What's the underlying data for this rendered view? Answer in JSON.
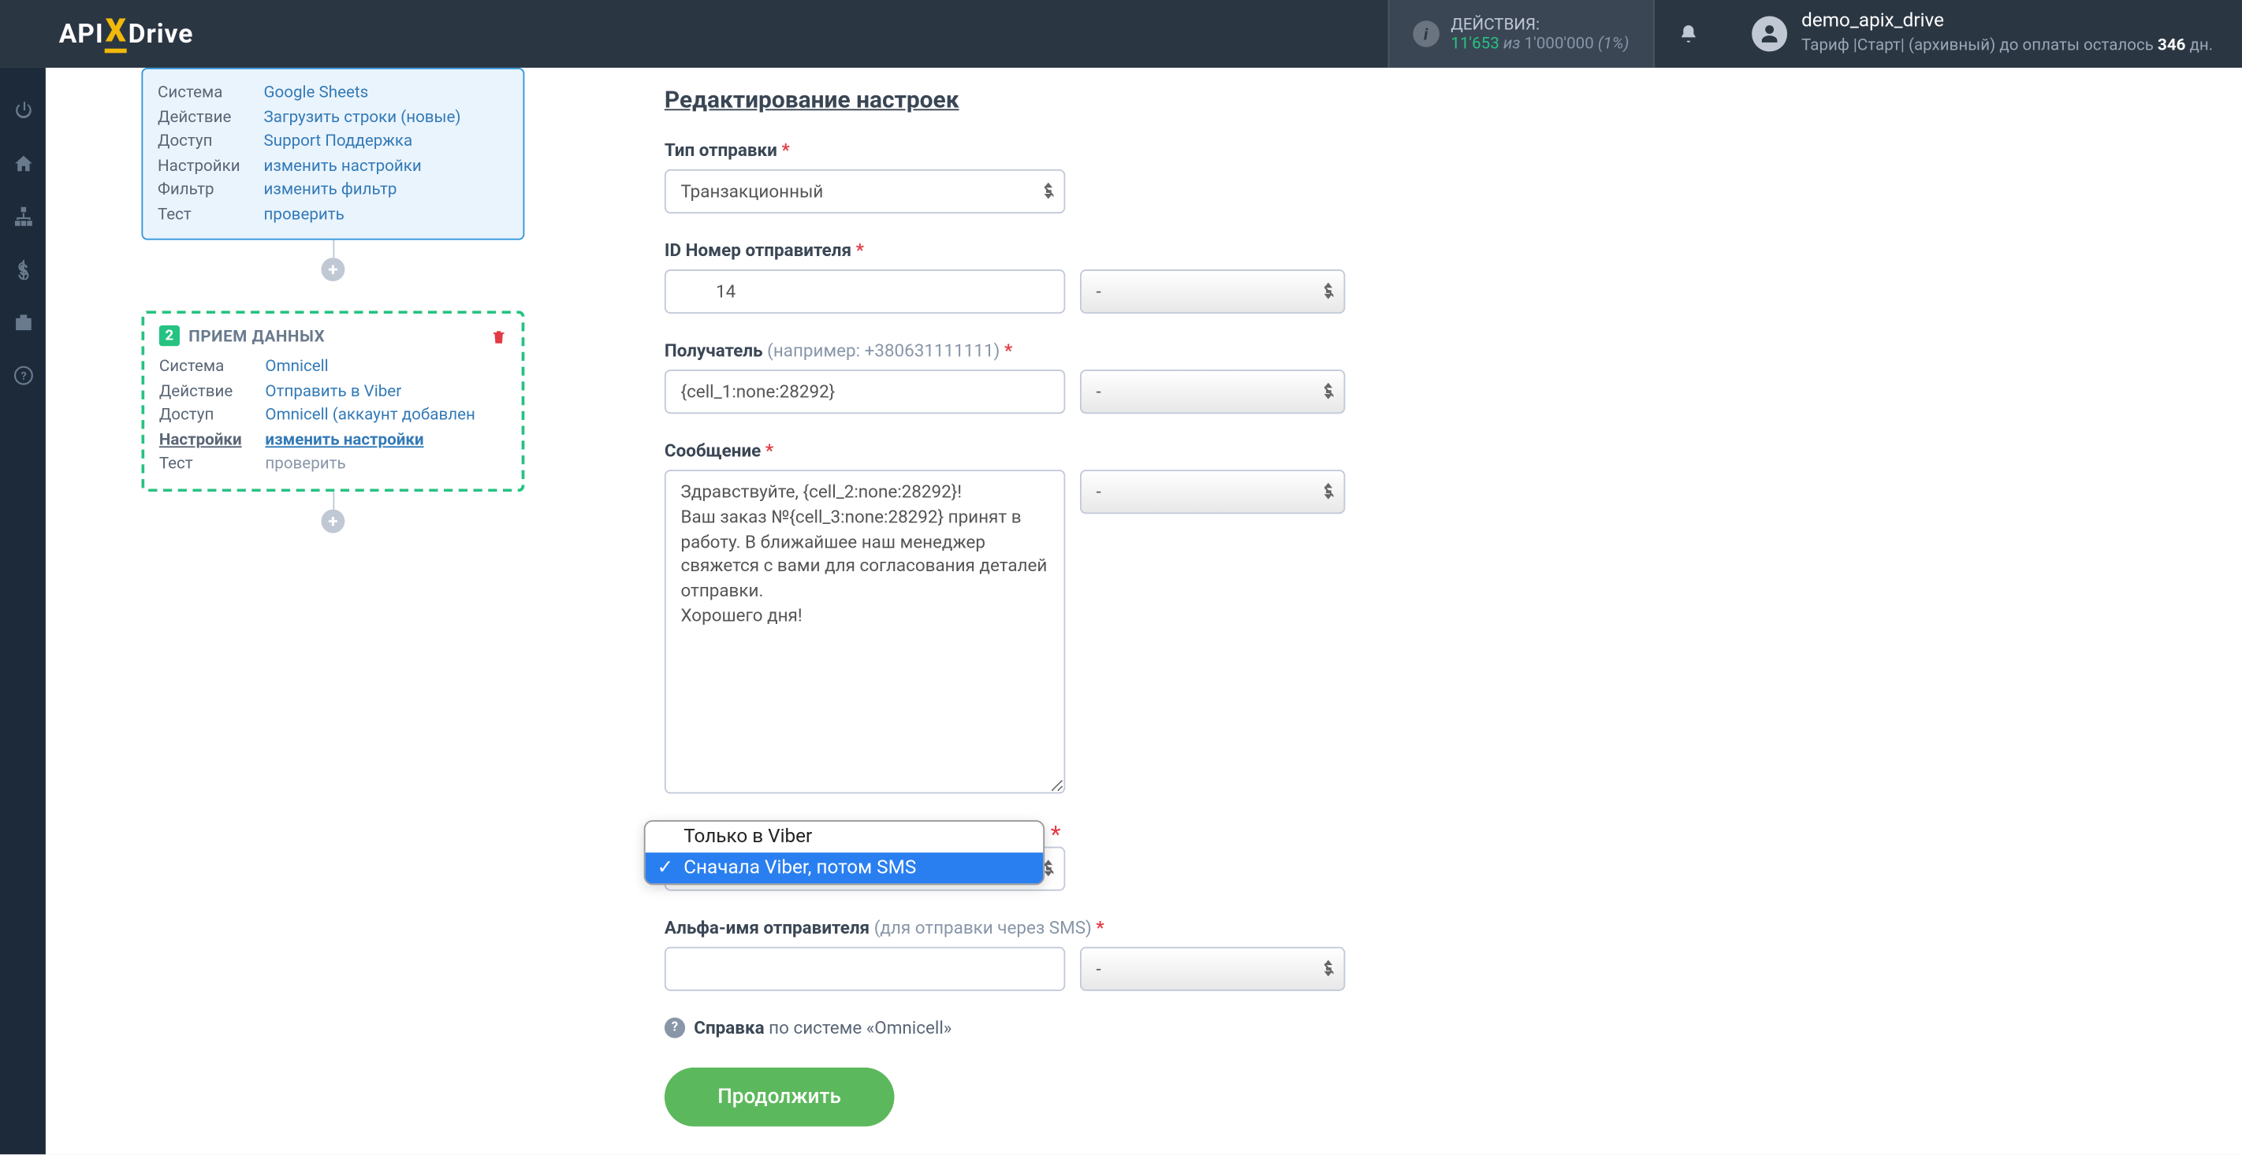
{
  "header": {
    "logo_prefix": "API",
    "logo_x": "X",
    "logo_suffix": "Drive",
    "actions": {
      "label": "действия:",
      "current": "11'653",
      "of_word": "из",
      "total": "1'000'000",
      "percent": "(1%)"
    },
    "user": {
      "name": "demo_apix_drive",
      "tariff_prefix": "Тариф |Старт| (архивный) до оплаты осталось ",
      "tariff_days": "346",
      "tariff_suffix": " дн."
    }
  },
  "sidebar": {
    "step1": {
      "rows": [
        {
          "label": "Система",
          "value": "Google Sheets",
          "link": true
        },
        {
          "label": "Действие",
          "value": "Загрузить строки (новые)",
          "link": true
        },
        {
          "label": "Доступ",
          "value": "Support Поддержка",
          "link": true
        },
        {
          "label": "Настройки",
          "value": "изменить настройки",
          "link": true
        },
        {
          "label": "Фильтр",
          "value": "изменить фильтр",
          "link": true
        },
        {
          "label": "Тест",
          "value": "проверить",
          "link": true
        }
      ]
    },
    "step2": {
      "num": "2",
      "title": "ПРИЕМ ДАННЫХ",
      "rows": [
        {
          "label": "Система",
          "value": "Omnicell",
          "link": true
        },
        {
          "label": "Действие",
          "value": "Отправить в Viber",
          "link": true
        },
        {
          "label": "Доступ",
          "value": "Omnicell (аккаунт добавлен",
          "link": true
        },
        {
          "label": "Настройки",
          "value": "изменить настройки",
          "link": true,
          "active": true
        },
        {
          "label": "Тест",
          "value": "проверить",
          "link": false
        }
      ]
    }
  },
  "form": {
    "title": "Редактирование настроек",
    "fields": {
      "send_type": {
        "label": "Тип отправки",
        "value": "Транзакционный"
      },
      "sender_id": {
        "label": "ID Номер отправителя",
        "value": "        14",
        "select": "-"
      },
      "recipient": {
        "label": "Получатель",
        "hint": "(например: +380631111111)",
        "value": "{cell_1:none:28292}",
        "select": "-"
      },
      "message": {
        "label": "Сообщение",
        "value": "Здравствуйте, {cell_2:none:28292}!\nВаш заказ №{cell_3:none:28292} принят в работу. В ближайшее наш менеджер свяжется с вами для согласования деталей отправки.\nХорошего дня!",
        "select": "-"
      },
      "channel": {
        "options": [
          {
            "text": "Только в Viber",
            "selected": false
          },
          {
            "text": "Сначала Viber, потом SMS",
            "selected": true
          }
        ]
      },
      "alpha_name": {
        "label": "Альфа-имя отправителя",
        "hint": "(для отправки через SMS)",
        "value": "",
        "select": "-"
      }
    },
    "help": {
      "prefix": "Справка",
      "mid": " по системе «",
      "system": "Omnicell",
      "suffix": "»"
    },
    "continue_btn": "Продолжить"
  }
}
